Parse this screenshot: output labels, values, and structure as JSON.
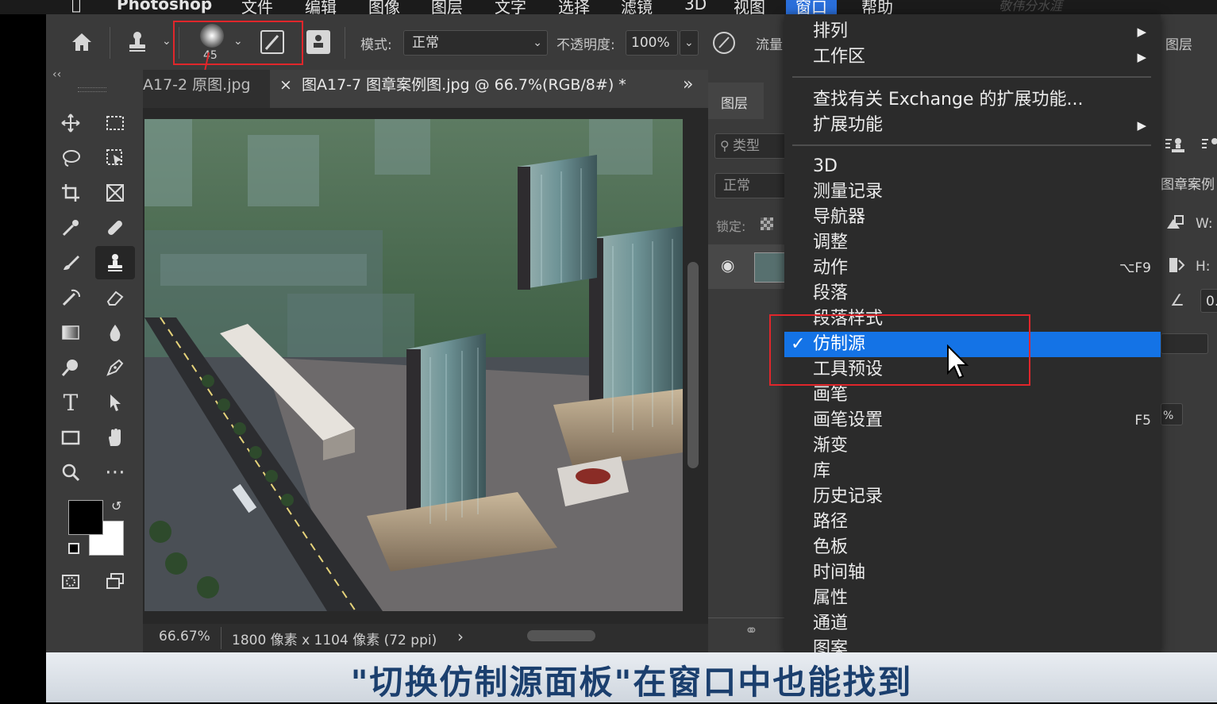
{
  "menubar": {
    "items": [
      "Photoshop",
      "文件",
      "编辑",
      "图像",
      "图层",
      "文字",
      "选择",
      "滤镜",
      "3D",
      "视图",
      "窗口",
      "帮助"
    ],
    "active": "窗口",
    "watermark": "敬伟分水涯"
  },
  "options": {
    "brush_size": "45",
    "mode_label": "模式:",
    "mode_value": "正常",
    "opacity_label": "不透明度:",
    "opacity_value": "100%",
    "flow_label": "流量",
    "layer_tail": "图层"
  },
  "tabs": {
    "collapse": "‹‹",
    "tab1": "A17-2 原图.jpg",
    "close": "×",
    "tab2": "图A17-7 图章案例图.jpg @ 66.7%(RGB/8#) *",
    "more": "»"
  },
  "status": {
    "zoom": "66.67%",
    "doc_info": "1800 像素 x 1104 像素 (72 ppi)",
    "arrow": "›"
  },
  "layers_panel": {
    "tab": "图层",
    "search": "类型",
    "blend": "正常",
    "lock": "锁定:"
  },
  "right_panel": {
    "doc_name": "图章案例",
    "w": "W:",
    "h": "H:",
    "angle_val": "0.",
    "pct": "%"
  },
  "window_menu": {
    "group1": [
      {
        "label": "排列",
        "submenu": true
      },
      {
        "label": "工作区",
        "submenu": true
      }
    ],
    "group2": [
      {
        "label": "查找有关 Exchange 的扩展功能...",
        "submenu": false
      },
      {
        "label": "扩展功能",
        "submenu": true
      }
    ],
    "group3": [
      {
        "label": "3D"
      },
      {
        "label": "测量记录"
      },
      {
        "label": "导航器"
      },
      {
        "label": "调整"
      },
      {
        "label": "动作",
        "shortcut": "⌥F9"
      },
      {
        "label": "段落"
      },
      {
        "label": "段落样式"
      },
      {
        "label": "仿制源",
        "checked": true,
        "highlighted": true
      },
      {
        "label": "工具预设"
      },
      {
        "label": "画笔"
      },
      {
        "label": "画笔设置",
        "shortcut": "F5"
      },
      {
        "label": "渐变"
      },
      {
        "label": "库"
      },
      {
        "label": "历史记录"
      },
      {
        "label": "路径"
      },
      {
        "label": "色板"
      },
      {
        "label": "时间轴"
      },
      {
        "label": "属性"
      },
      {
        "label": "通道"
      },
      {
        "label": "图案"
      }
    ],
    "check": "✓",
    "arrow": "▶"
  },
  "caption": "\"切换仿制源面板\"在窗口中也能找到",
  "colors": {
    "highlight": "#1473e6",
    "annotation_red": "#e0262b",
    "caption_text": "#1b3f6e"
  }
}
